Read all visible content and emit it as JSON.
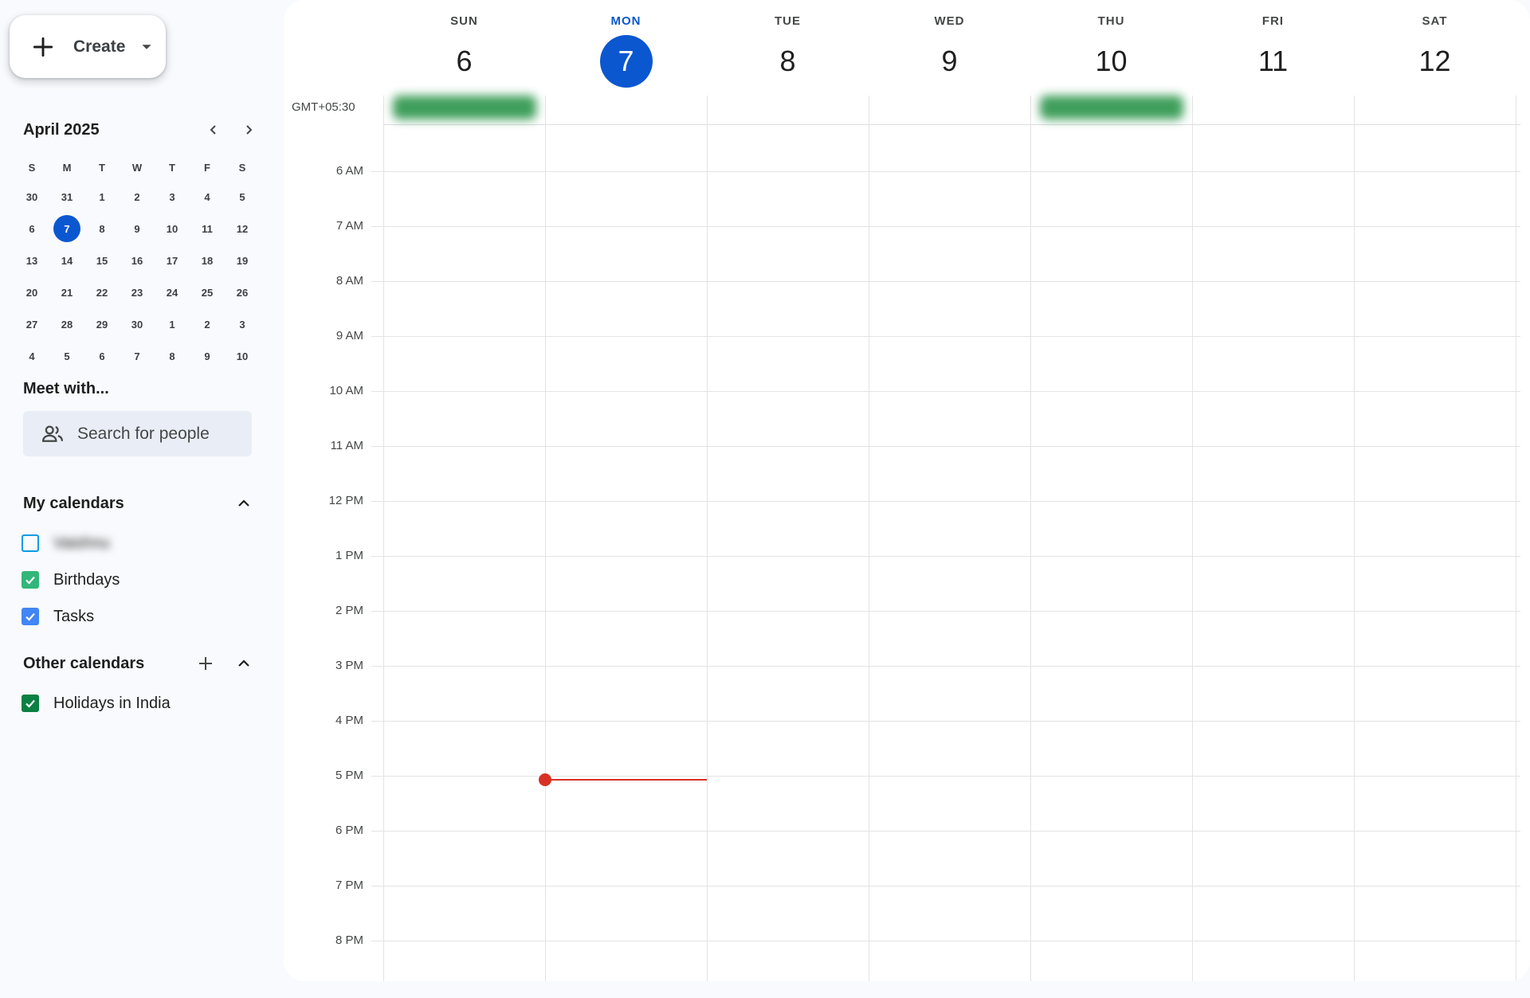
{
  "sidebar": {
    "create_label": "Create",
    "mini_calendar": {
      "title": "April 2025",
      "weekdays": [
        "S",
        "M",
        "T",
        "W",
        "T",
        "F",
        "S"
      ],
      "weeks": [
        [
          "30",
          "31",
          "1",
          "2",
          "3",
          "4",
          "5"
        ],
        [
          "6",
          "7",
          "8",
          "9",
          "10",
          "11",
          "12"
        ],
        [
          "13",
          "14",
          "15",
          "16",
          "17",
          "18",
          "19"
        ],
        [
          "20",
          "21",
          "22",
          "23",
          "24",
          "25",
          "26"
        ],
        [
          "27",
          "28",
          "29",
          "30",
          "1",
          "2",
          "3"
        ],
        [
          "4",
          "5",
          "6",
          "7",
          "8",
          "9",
          "10"
        ]
      ],
      "today": "7"
    },
    "meet_with": {
      "title": "Meet with...",
      "placeholder": "Search for people"
    },
    "my_calendars": {
      "title": "My calendars",
      "items": [
        {
          "label": "Vaishnu",
          "checked": false,
          "color": "#039be5",
          "blurred": true
        },
        {
          "label": "Birthdays",
          "checked": true,
          "color": "#33b679"
        },
        {
          "label": "Tasks",
          "checked": true,
          "color": "#4285f4"
        }
      ]
    },
    "other_calendars": {
      "title": "Other calendars",
      "items": [
        {
          "label": "Holidays in India",
          "checked": true,
          "color": "#0b8043"
        }
      ]
    }
  },
  "week": {
    "timezone": "GMT+05:30",
    "days": [
      {
        "name": "SUN",
        "num": "6"
      },
      {
        "name": "MON",
        "num": "7",
        "today": true
      },
      {
        "name": "TUE",
        "num": "8"
      },
      {
        "name": "WED",
        "num": "9"
      },
      {
        "name": "THU",
        "num": "10"
      },
      {
        "name": "FRI",
        "num": "11"
      },
      {
        "name": "SAT",
        "num": "12"
      }
    ],
    "all_day_event_days": [
      0,
      4
    ],
    "hours": [
      "6 AM",
      "7 AM",
      "8 AM",
      "9 AM",
      "10 AM",
      "11 AM",
      "12 PM",
      "1 PM",
      "2 PM",
      "3 PM",
      "4 PM",
      "5 PM",
      "6 PM",
      "7 PM",
      "8 PM"
    ],
    "current_time": {
      "day_index": 1,
      "hour_offset": 11.07
    },
    "colors": {
      "accent": "#0b57d0",
      "now": "#d93025",
      "event": "#1e8e3e"
    }
  }
}
